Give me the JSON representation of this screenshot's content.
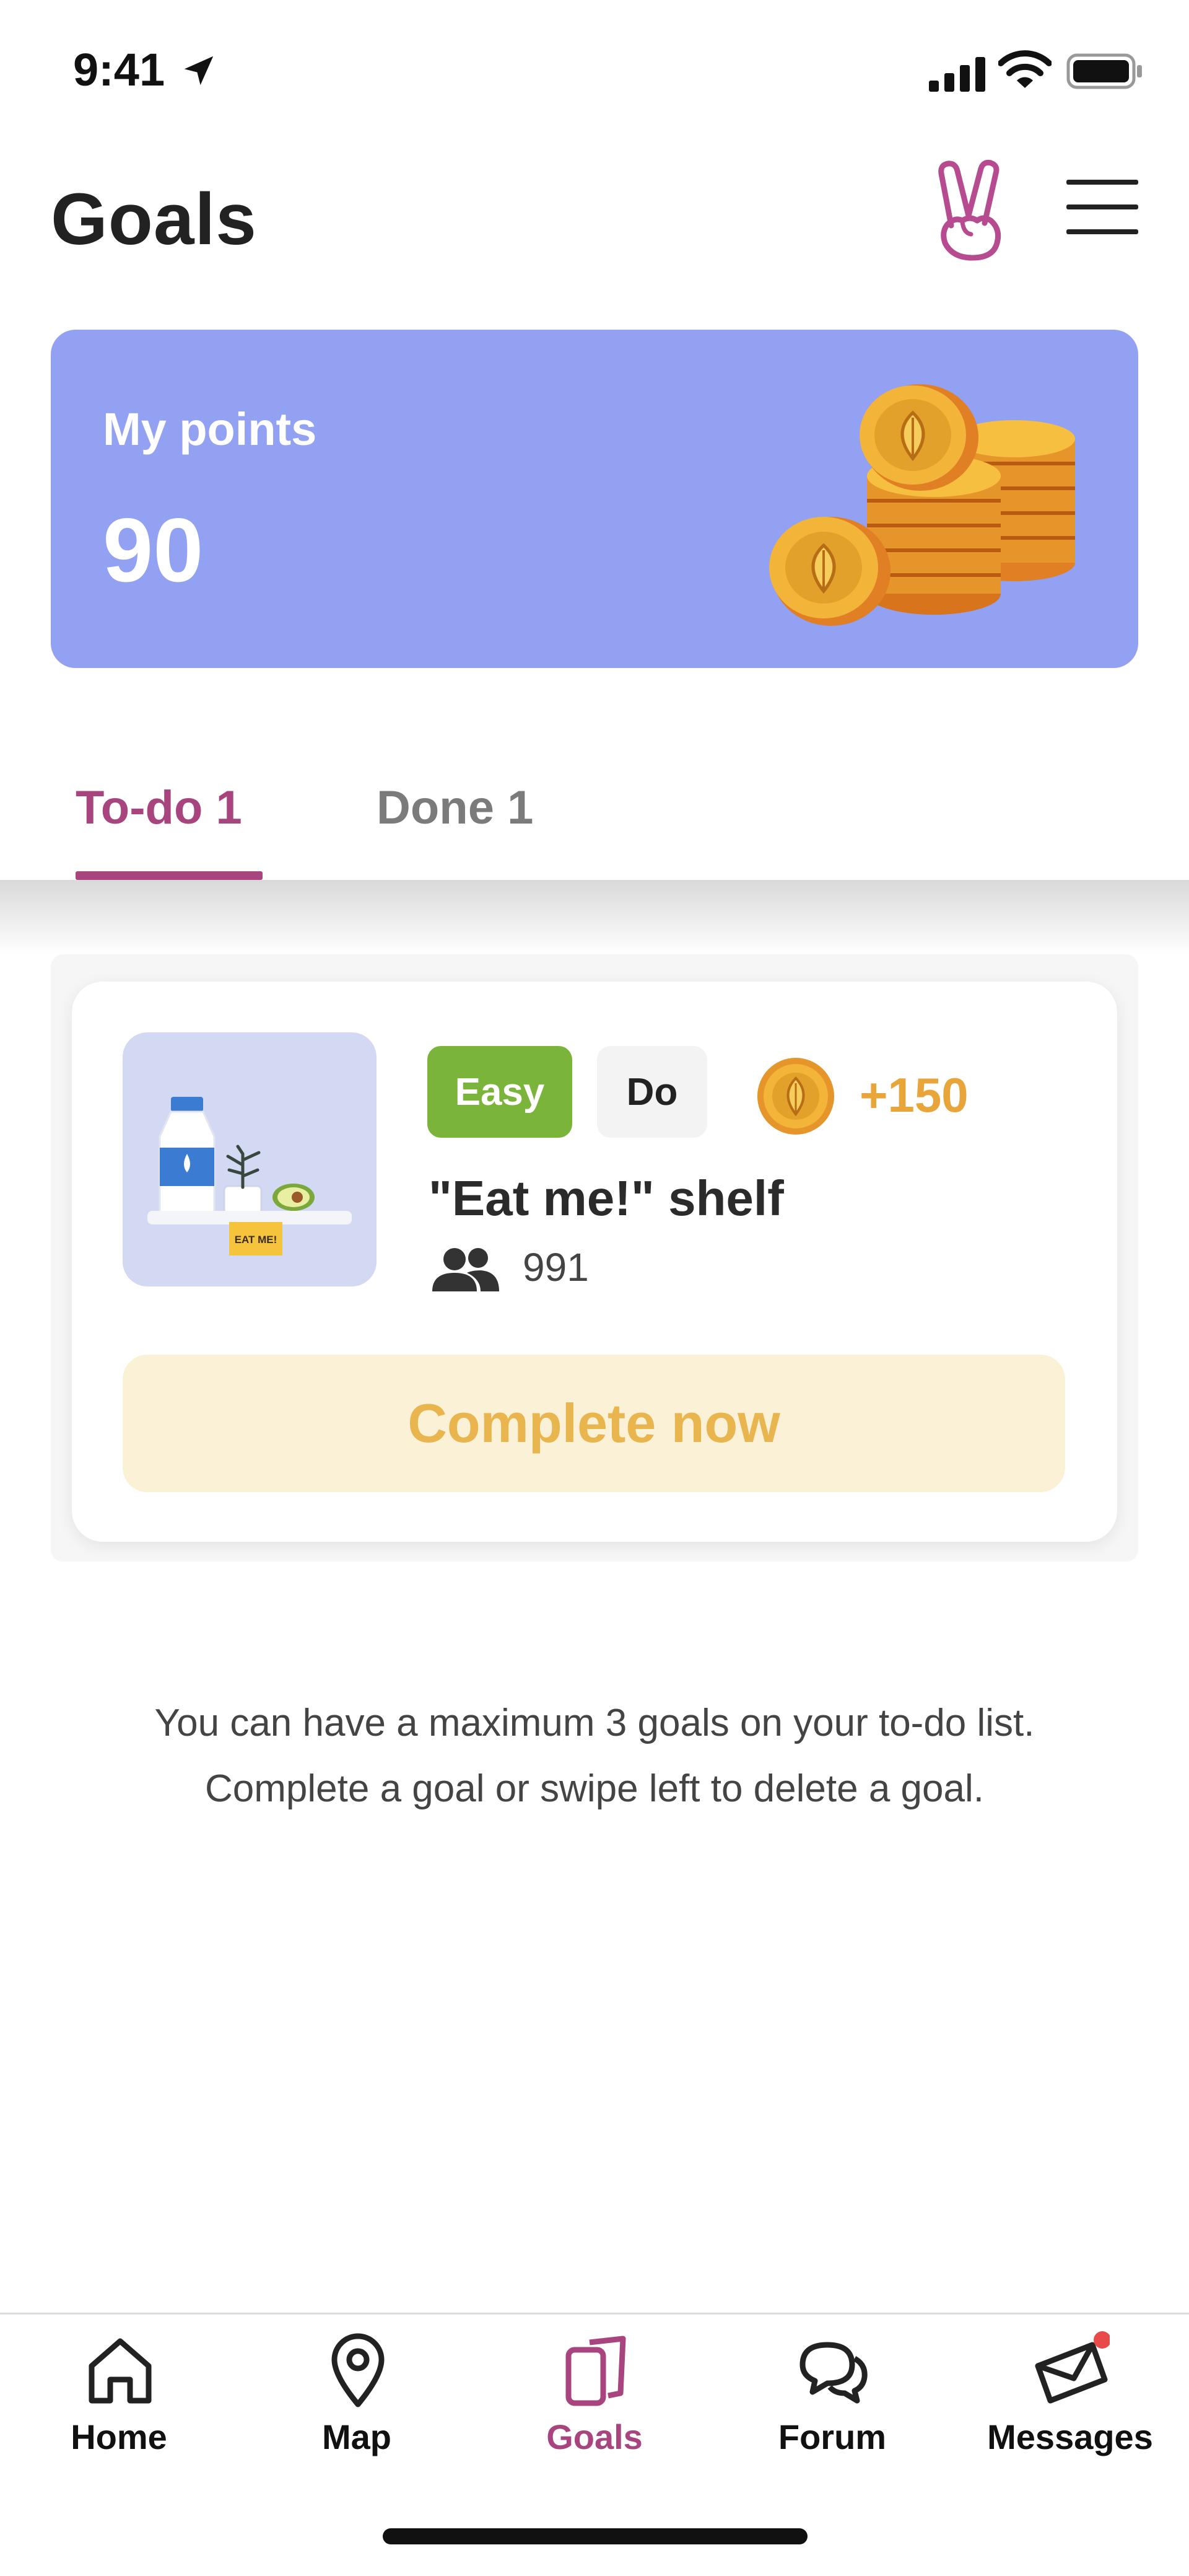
{
  "status_bar": {
    "time": "9:41"
  },
  "header": {
    "title": "Goals"
  },
  "points_card": {
    "label": "My points",
    "value": "90"
  },
  "tabs": [
    {
      "label": "To-do 1",
      "active": true
    },
    {
      "label": "Done 1",
      "active": false
    }
  ],
  "goal": {
    "difficulty": "Easy",
    "type": "Do",
    "reward": "+150",
    "title": "\"Eat me!\" shelf",
    "participants": "991",
    "thumb_label": "EAT ME!",
    "action_label": "Complete now"
  },
  "info": {
    "line1": "You can have a maximum 3 goals on your to-do list.",
    "line2": "Complete a goal or swipe left to delete a goal."
  },
  "nav": [
    {
      "label": "Home",
      "icon": "home-icon"
    },
    {
      "label": "Map",
      "icon": "map-pin-icon"
    },
    {
      "label": "Goals",
      "icon": "goals-cards-icon",
      "active": true
    },
    {
      "label": "Forum",
      "icon": "chat-bubbles-icon"
    },
    {
      "label": "Messages",
      "icon": "envelope-icon",
      "has_badge": true
    }
  ],
  "colors": {
    "accent": "#a8457f",
    "points_card": "#93a1f2",
    "easy_tag": "#7bb43a",
    "reward": "#e8a53a",
    "complete_button_bg": "#fbf1d6",
    "complete_button_text": "#e8b54f",
    "badge": "#e84a4a"
  }
}
